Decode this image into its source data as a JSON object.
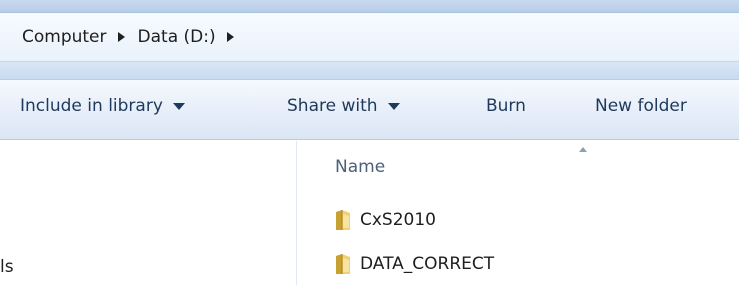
{
  "address": {
    "crumbs": [
      {
        "label": "Computer"
      },
      {
        "label": "Data (D:)"
      }
    ]
  },
  "toolbar": {
    "include_label": "Include in library",
    "share_label": "Share with",
    "burn_label": "Burn",
    "new_folder_label": "New folder"
  },
  "navigation": {
    "partial_text": "ls"
  },
  "file_list": {
    "name_header": "Name",
    "items": [
      {
        "name": "CxS2010",
        "icon": "folder-icon"
      },
      {
        "name": "DATA_CORRECT",
        "icon": "folder-icon"
      }
    ]
  }
}
